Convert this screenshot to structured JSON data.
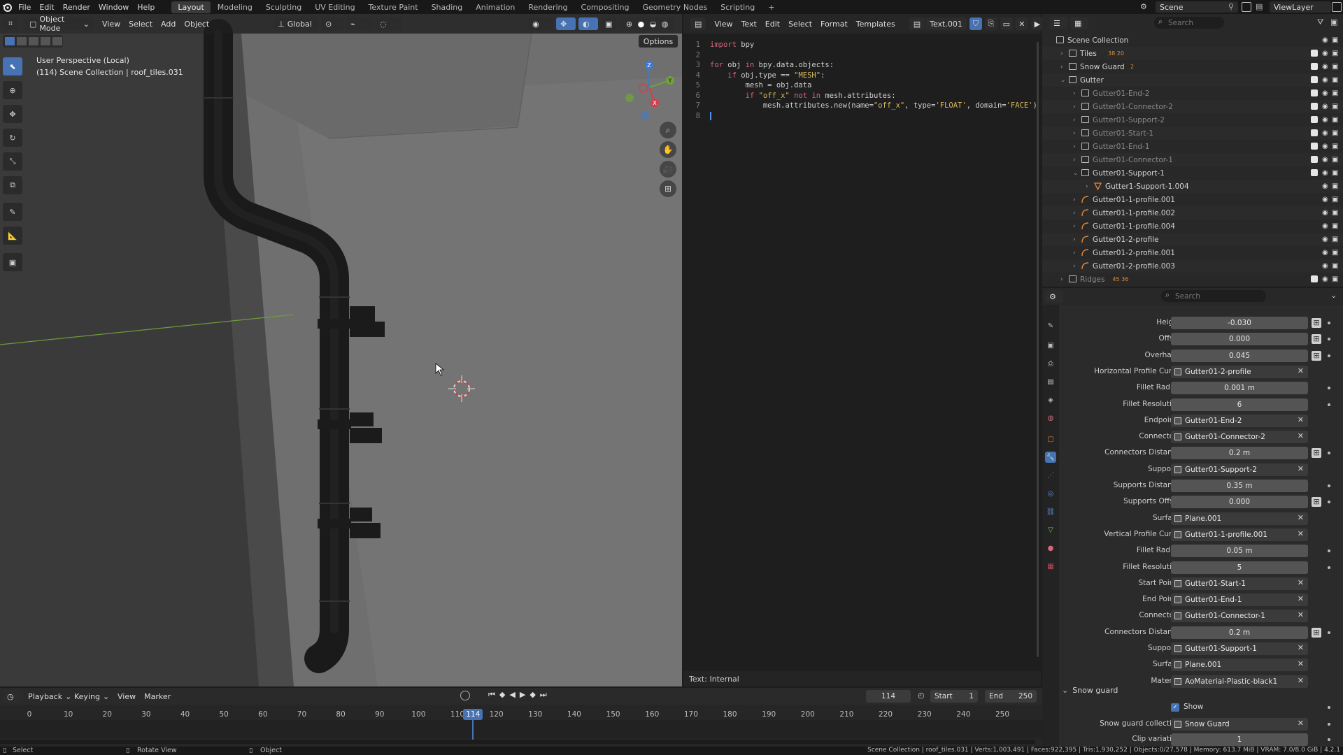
{
  "topbar": {
    "menus": [
      "File",
      "Edit",
      "Render",
      "Window",
      "Help"
    ],
    "workspaces": [
      "Layout",
      "Modeling",
      "Sculpting",
      "UV Editing",
      "Texture Paint",
      "Shading",
      "Animation",
      "Rendering",
      "Compositing",
      "Geometry Nodes",
      "Scripting"
    ],
    "active_workspace": "Layout",
    "add_tab": "+",
    "scene": "Scene",
    "view_layer": "ViewLayer"
  },
  "viewport": {
    "mode": "Object Mode",
    "menus": [
      "View",
      "Select",
      "Add",
      "Object"
    ],
    "orientation": "Global",
    "options": "Options",
    "overlay_title": "User Perspective (Local)",
    "overlay_info": "(114) Scene Collection | roof_tiles.031",
    "axes": {
      "x": "X",
      "y": "Y",
      "z": "Z"
    }
  },
  "text_editor": {
    "menus": [
      "View",
      "Text",
      "Edit",
      "Select",
      "Format",
      "Templates"
    ],
    "file_name": "Text.001",
    "footer": "Text: Internal",
    "lines": [
      {
        "n": "1",
        "tokens": [
          {
            "t": "import",
            "c": "kw"
          },
          {
            "t": " bpy",
            "c": "plain"
          }
        ]
      },
      {
        "n": "2",
        "tokens": []
      },
      {
        "n": "3",
        "tokens": [
          {
            "t": "for",
            "c": "kw"
          },
          {
            "t": " obj ",
            "c": "plain"
          },
          {
            "t": "in",
            "c": "kw"
          },
          {
            "t": " bpy.data.objects:",
            "c": "plain"
          }
        ]
      },
      {
        "n": "4",
        "tokens": [
          {
            "t": "    ",
            "c": "plain"
          },
          {
            "t": "if",
            "c": "kw"
          },
          {
            "t": " obj.type == ",
            "c": "plain"
          },
          {
            "t": "\"MESH\"",
            "c": "str"
          },
          {
            "t": ":",
            "c": "plain"
          }
        ]
      },
      {
        "n": "5",
        "tokens": [
          {
            "t": "        mesh = obj.data",
            "c": "plain"
          }
        ]
      },
      {
        "n": "6",
        "tokens": [
          {
            "t": "        ",
            "c": "plain"
          },
          {
            "t": "if",
            "c": "kw"
          },
          {
            "t": " ",
            "c": "plain"
          },
          {
            "t": "\"off_x\"",
            "c": "str"
          },
          {
            "t": " ",
            "c": "plain"
          },
          {
            "t": "not in",
            "c": "kw"
          },
          {
            "t": " mesh.attributes:",
            "c": "plain"
          }
        ]
      },
      {
        "n": "7",
        "tokens": [
          {
            "t": "            mesh.attributes.new(name=",
            "c": "plain"
          },
          {
            "t": "\"off_x\"",
            "c": "str"
          },
          {
            "t": ", type=",
            "c": "plain"
          },
          {
            "t": "'FLOAT'",
            "c": "str"
          },
          {
            "t": ", domain=",
            "c": "plain"
          },
          {
            "t": "'FACE'",
            "c": "str"
          },
          {
            "t": ")",
            "c": "plain"
          }
        ]
      },
      {
        "n": "8",
        "tokens": []
      }
    ]
  },
  "outliner": {
    "search_placeholder": "Search",
    "rows": [
      {
        "label": "Scene Collection",
        "indent": 0,
        "arrow": "",
        "kind": "collection",
        "dim": false
      },
      {
        "label": "Tiles",
        "indent": 1,
        "arrow": "›",
        "kind": "collection",
        "dim": false,
        "badge": "38 20"
      },
      {
        "label": "Snow Guard",
        "indent": 1,
        "arrow": "›",
        "kind": "collection",
        "dim": false,
        "badge": "2"
      },
      {
        "label": "Gutter",
        "indent": 1,
        "arrow": "⌄",
        "kind": "collection",
        "dim": false
      },
      {
        "label": "Gutter01-End-2",
        "indent": 2,
        "arrow": "›",
        "kind": "collection",
        "dim": true
      },
      {
        "label": "Gutter01-Connector-2",
        "indent": 2,
        "arrow": "›",
        "kind": "collection",
        "dim": true
      },
      {
        "label": "Gutter01-Support-2",
        "indent": 2,
        "arrow": "›",
        "kind": "collection",
        "dim": true
      },
      {
        "label": "Gutter01-Start-1",
        "indent": 2,
        "arrow": "›",
        "kind": "collection",
        "dim": true
      },
      {
        "label": "Gutter01-End-1",
        "indent": 2,
        "arrow": "›",
        "kind": "collection",
        "dim": true
      },
      {
        "label": "Gutter01-Connector-1",
        "indent": 2,
        "arrow": "›",
        "kind": "collection",
        "dim": true
      },
      {
        "label": "Gutter01-Support-1",
        "indent": 2,
        "arrow": "⌄",
        "kind": "collection",
        "dim": false
      },
      {
        "label": "Gutter1-Support-1.004",
        "indent": 3,
        "arrow": "›",
        "kind": "mesh",
        "dim": false
      },
      {
        "label": "Gutter01-1-profile.001",
        "indent": 2,
        "arrow": "›",
        "kind": "curve",
        "dim": false
      },
      {
        "label": "Gutter01-1-profile.002",
        "indent": 2,
        "arrow": "›",
        "kind": "curve",
        "dim": false
      },
      {
        "label": "Gutter01-1-profile.004",
        "indent": 2,
        "arrow": "›",
        "kind": "curve",
        "dim": false
      },
      {
        "label": "Gutter01-2-profile",
        "indent": 2,
        "arrow": "›",
        "kind": "curve",
        "dim": false
      },
      {
        "label": "Gutter01-2-profile.001",
        "indent": 2,
        "arrow": "›",
        "kind": "curve",
        "dim": false
      },
      {
        "label": "Gutter01-2-profile.003",
        "indent": 2,
        "arrow": "›",
        "kind": "curve",
        "dim": false
      },
      {
        "label": "Ridges",
        "indent": 1,
        "arrow": "›",
        "kind": "collection",
        "dim": true,
        "badge": "45 36"
      }
    ]
  },
  "properties": {
    "search_placeholder": "Search",
    "rows": [
      {
        "label": "Height",
        "value": "-0.030",
        "type": "num",
        "extra": true
      },
      {
        "label": "Offset",
        "value": "0.000",
        "type": "num",
        "extra": true
      },
      {
        "label": "Overhang",
        "value": "0.045",
        "type": "num",
        "extra": true
      },
      {
        "label": "Horizontal Profile Curve",
        "value": "Gutter01-2-profile",
        "type": "obj"
      },
      {
        "label": "Fillet Radius",
        "value": "0.001 m",
        "type": "num"
      },
      {
        "label": "Fillet Resolution",
        "value": "6",
        "type": "num"
      },
      {
        "label": "Endpoints",
        "value": "Gutter01-End-2",
        "type": "obj"
      },
      {
        "label": "Connectors",
        "value": "Gutter01-Connector-2",
        "type": "obj"
      },
      {
        "label": "Connectors Distance",
        "value": "0.2 m",
        "type": "num",
        "extra": true
      },
      {
        "label": "Supports",
        "value": "Gutter01-Support-2",
        "type": "obj"
      },
      {
        "label": "Supports Distance",
        "value": "0.35 m",
        "type": "num"
      },
      {
        "label": "Supports Offset",
        "value": "0.000",
        "type": "num",
        "extra": true
      },
      {
        "label": "Surface",
        "value": "Plane.001",
        "type": "obj"
      },
      {
        "label": "Vertical Profile Curve",
        "value": "Gutter01-1-profile.001",
        "type": "obj"
      },
      {
        "label": "Fillet Radius",
        "value": "0.05 m",
        "type": "num"
      },
      {
        "label": "Fillet Resolution",
        "value": "5",
        "type": "num"
      },
      {
        "label": "Start Points",
        "value": "Gutter01-Start-1",
        "type": "obj"
      },
      {
        "label": "End Points",
        "value": "Gutter01-End-1",
        "type": "obj"
      },
      {
        "label": "Connectors",
        "value": "Gutter01-Connector-1",
        "type": "obj"
      },
      {
        "label": "Connectors Distance",
        "value": "0.2 m",
        "type": "num",
        "extra": true
      },
      {
        "label": "Supports",
        "value": "Gutter01-Support-1",
        "type": "obj"
      },
      {
        "label": "Surface",
        "value": "Plane.001",
        "type": "obj"
      },
      {
        "label": "Material",
        "value": "AoMaterial-Plastic-black1",
        "type": "obj"
      }
    ],
    "panel_snow_guard": "Snow guard",
    "show_label": "Show",
    "snow_guard_collection_label": "Snow guard collection",
    "snow_guard_collection_value": "Snow Guard",
    "clip_variation_label": "Clip variation",
    "clip_variation_value": "1"
  },
  "timeline": {
    "menus": [
      "Playback",
      "Keying",
      "View",
      "Marker"
    ],
    "current_frame": "114",
    "start_label": "Start",
    "start": "1",
    "end_label": "End",
    "end": "250",
    "ticks": [
      "0",
      "10",
      "20",
      "30",
      "40",
      "50",
      "60",
      "70",
      "80",
      "90",
      "100",
      "110",
      "120",
      "130",
      "140",
      "150",
      "160",
      "170",
      "180",
      "190",
      "200",
      "210",
      "220",
      "230",
      "240",
      "250"
    ]
  },
  "statusbar": {
    "left": [
      "Select",
      "Rotate View",
      "Object"
    ],
    "right": "Scene Collection | roof_tiles.031 | Verts:1,003,491 | Faces:922,395 | Tris:1,930,252 | Objects:0/27,578 | Memory: 613.7 MiB | VRAM: 7.0/8.0 GiB | 4.2.1"
  },
  "colors": {
    "accent": "#4772b3",
    "playhead": "#4772b3",
    "keyword": "#d2667c",
    "string": "#d8b95a"
  }
}
